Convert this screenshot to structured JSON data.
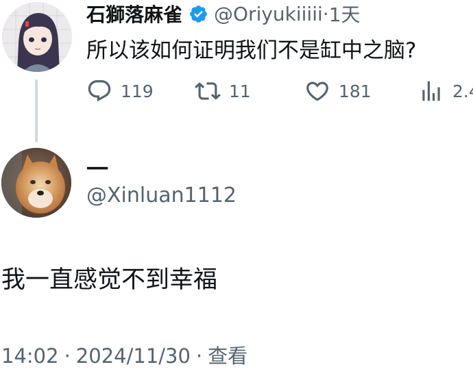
{
  "parent_tweet": {
    "display_name": "石獅落麻雀",
    "handle": "@Oriyukiiiii",
    "separator": "·",
    "time_ago": "1天",
    "text": "所以该如何证明我们不是缸中之脑?",
    "actions": {
      "replies": "119",
      "retweets": "11",
      "likes": "181",
      "views": "2.4"
    },
    "verified": true
  },
  "main_tweet": {
    "display_name": "一",
    "handle": "@Xinluan1112",
    "text": "我一直感觉不到幸福",
    "time": "14:02",
    "date": "2024/11/30",
    "views_label": "查看",
    "separator": "·"
  },
  "colors": {
    "text_primary": "#0f1419",
    "text_secondary": "#536471",
    "verified_blue": "#1d9bf0",
    "thread_line": "#cfd9de"
  },
  "icons": [
    "reply-icon",
    "retweet-icon",
    "like-icon",
    "views-icon",
    "verified-badge-icon"
  ]
}
